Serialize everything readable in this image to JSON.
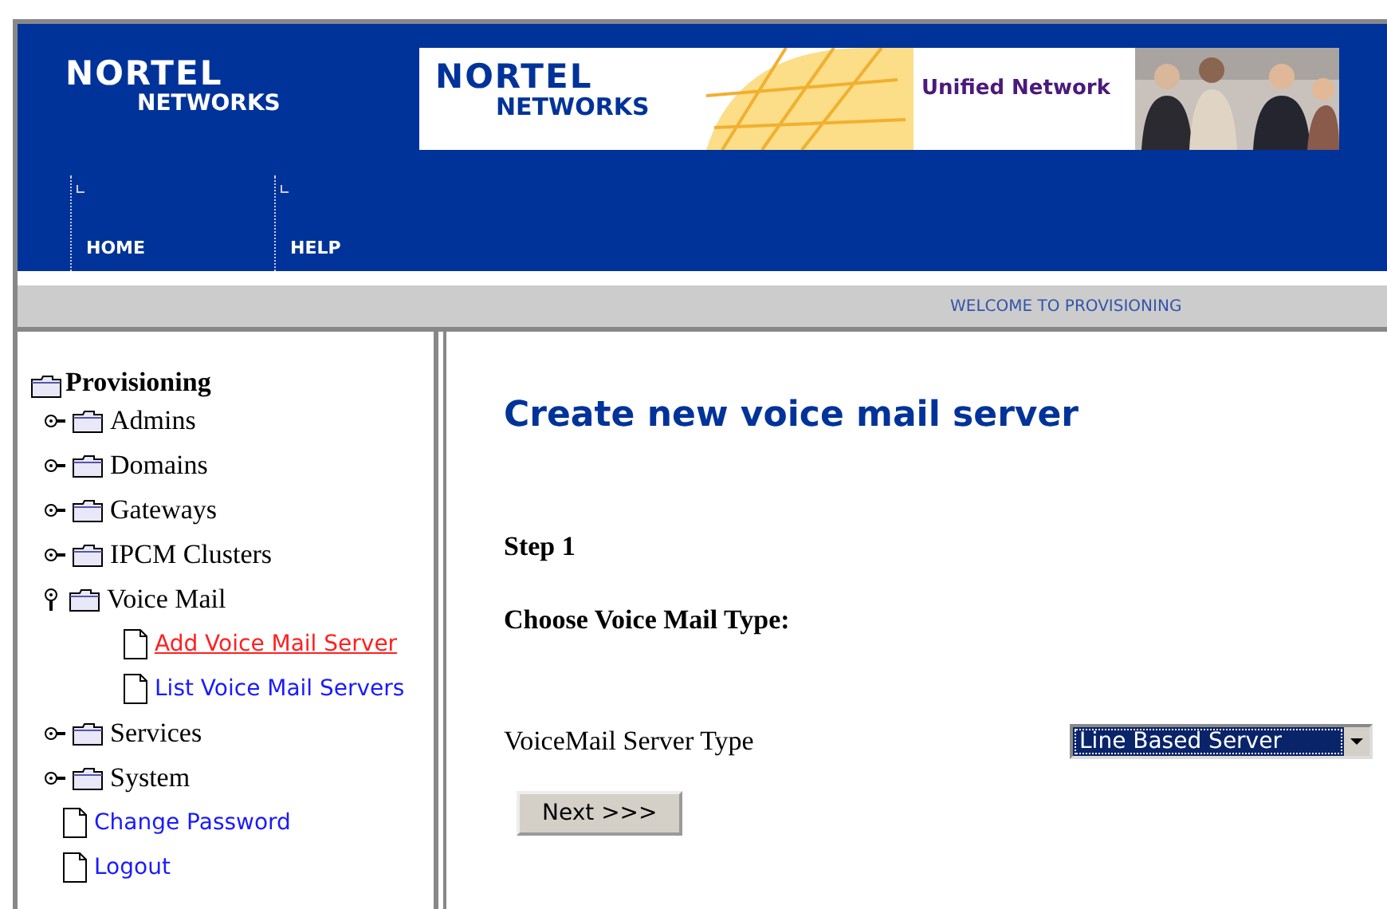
{
  "header": {
    "logo": {
      "line1": "NORTEL",
      "line2": "NETWORKS"
    },
    "banner": {
      "logo_line1": "NORTEL",
      "logo_line2": "NETWORKS",
      "tagline": "Unified Network"
    },
    "nav": [
      {
        "label": "HOME"
      },
      {
        "label": "HELP"
      }
    ]
  },
  "welcome_bar": "WELCOME TO PROVISIONING",
  "sidebar": {
    "root": "Provisioning",
    "items": [
      {
        "kind": "folder",
        "label": "Admins",
        "expanded": false
      },
      {
        "kind": "folder",
        "label": "Domains",
        "expanded": false
      },
      {
        "kind": "folder",
        "label": "Gateways",
        "expanded": false
      },
      {
        "kind": "folder",
        "label": "IPCM Clusters",
        "expanded": false
      },
      {
        "kind": "folder",
        "label": "Voice Mail",
        "expanded": true,
        "children": [
          {
            "kind": "link",
            "label": "Add Voice Mail Server",
            "selected": true
          },
          {
            "kind": "link",
            "label": "List Voice Mail Servers",
            "selected": false
          }
        ]
      },
      {
        "kind": "folder",
        "label": "Services",
        "expanded": false
      },
      {
        "kind": "folder",
        "label": "System",
        "expanded": false
      },
      {
        "kind": "link",
        "label": "Change Password",
        "selected": false
      },
      {
        "kind": "link",
        "label": "Logout",
        "selected": false
      }
    ]
  },
  "content": {
    "title": "Create new voice mail server",
    "step": "Step 1",
    "subtitle": "Choose Voice Mail Type:",
    "field_label": "VoiceMail Server Type",
    "select_value": "Line Based Server",
    "button": "Next >>>"
  }
}
